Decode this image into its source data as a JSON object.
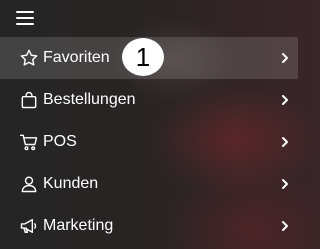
{
  "colors": {
    "text": "#ffffff",
    "active_bg": "rgba(255,255,255,0.14)",
    "badge_bg": "#ffffff",
    "badge_text": "#000000"
  },
  "header": {
    "menu_icon": "hamburger-icon"
  },
  "menu": {
    "items": [
      {
        "label": "Favoriten",
        "icon": "star-icon",
        "active": true
      },
      {
        "label": "Bestellungen",
        "icon": "shopping-bag-icon",
        "active": false
      },
      {
        "label": "POS",
        "icon": "cart-icon",
        "active": false
      },
      {
        "label": "Kunden",
        "icon": "user-icon",
        "active": false
      },
      {
        "label": "Marketing",
        "icon": "megaphone-icon",
        "active": false
      }
    ]
  },
  "badge": {
    "number": "1"
  }
}
